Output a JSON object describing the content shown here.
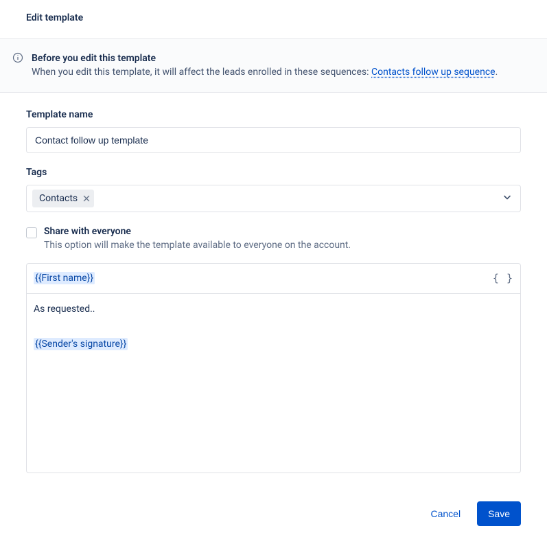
{
  "header": {
    "title": "Edit template"
  },
  "banner": {
    "heading": "Before you edit this template",
    "body_prefix": "When you edit this template, it will affect the leads enrolled in these sequences: ",
    "link_text": "Contacts follow up sequence",
    "body_suffix": "."
  },
  "form": {
    "name_label": "Template name",
    "name_value": "Contact follow up template",
    "tags_label": "Tags",
    "tags": [
      {
        "label": "Contacts"
      }
    ],
    "share_label": "Share with everyone",
    "share_help": "This option will make the template available to everyone on the account."
  },
  "editor": {
    "subject_token": "{{First name}}",
    "body_text": "As requested..",
    "signature_token": "{{Sender's signature}}"
  },
  "footer": {
    "cancel": "Cancel",
    "save": "Save"
  }
}
